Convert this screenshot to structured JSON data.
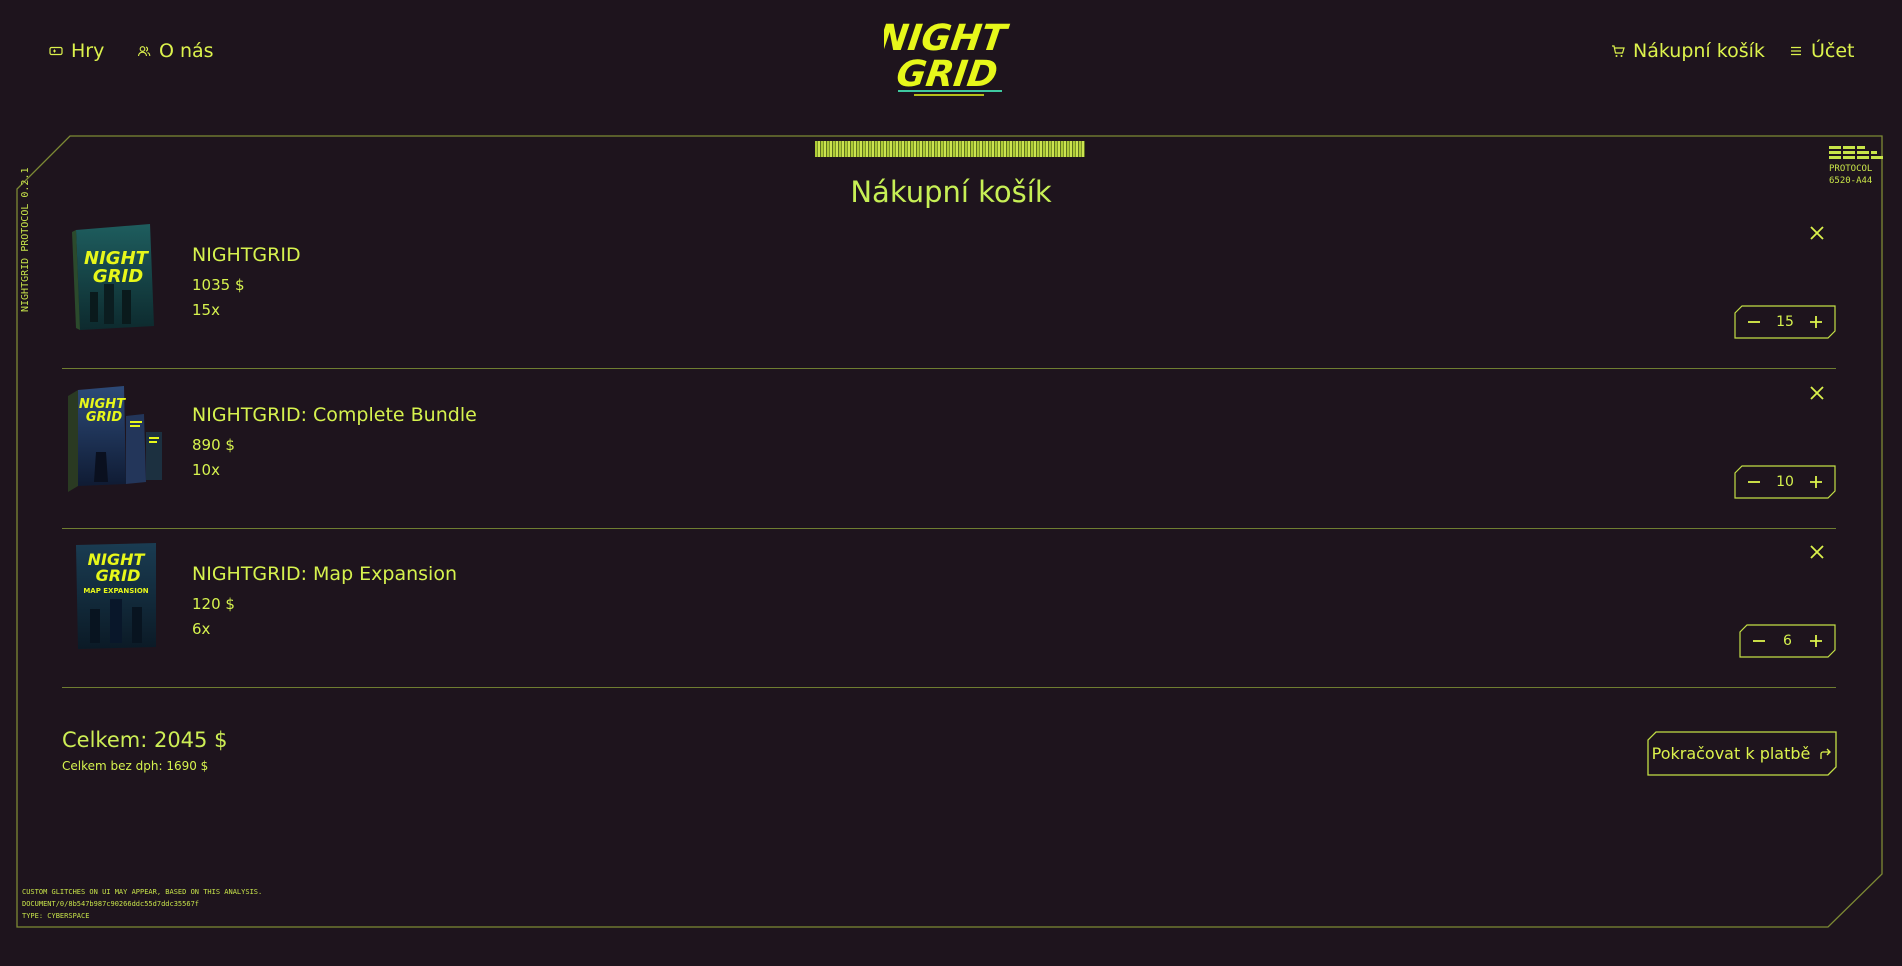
{
  "nav": {
    "games_label": "Hry",
    "about_label": "O nás",
    "cart_label": "Nákupní košík",
    "account_label": "Účet",
    "logo_text_top": "NIGHT",
    "logo_text_bottom": "GRID"
  },
  "frame": {
    "side_text": "NIGHTGRID PROTOCOL 0.2.1",
    "protocol_label": "PROTOCOL",
    "protocol_code": "6520-A44",
    "footer_lines": [
      "CUSTOM GLITCHES ON UI MAY APPEAR, BASED ON THIS ANALYSIS.",
      "DOCUMENT/0/8b547b987c90266ddc55d7ddc35567f",
      "TYPE: CYBERSPACE"
    ]
  },
  "page_title": "Nákupní košík",
  "items": [
    {
      "name": "NIGHTGRID",
      "price": "1035 $",
      "qty_text": "15x",
      "qty": "15",
      "cover_title_1": "NIGHT",
      "cover_title_2": "GRID",
      "cover_sub": ""
    },
    {
      "name": "NIGHTGRID: Complete Bundle",
      "price": "890 $",
      "qty_text": "10x",
      "qty": "10",
      "cover_title_1": "NIGHT",
      "cover_title_2": "GRID",
      "cover_sub": ""
    },
    {
      "name": "NIGHTGRID: Map Expansion",
      "price": "120 $",
      "qty_text": "6x",
      "qty": "6",
      "cover_title_1": "NIGHT",
      "cover_title_2": "GRID",
      "cover_sub": "MAP EXPANSION"
    }
  ],
  "summary": {
    "total": "Celkem: 2045 $",
    "subtotal": "Celkem bez dph: 1690 $",
    "checkout_label": "Pokračovat k platbě"
  },
  "colors": {
    "background": "#1e141d",
    "accent": "#d6f24e",
    "frame_line": "#7d8a34"
  },
  "icons": [
    "gamepad-icon",
    "users-icon",
    "cart-icon",
    "menu-icon",
    "close-icon",
    "minus-icon",
    "plus-icon",
    "forward-arrow-icon"
  ]
}
